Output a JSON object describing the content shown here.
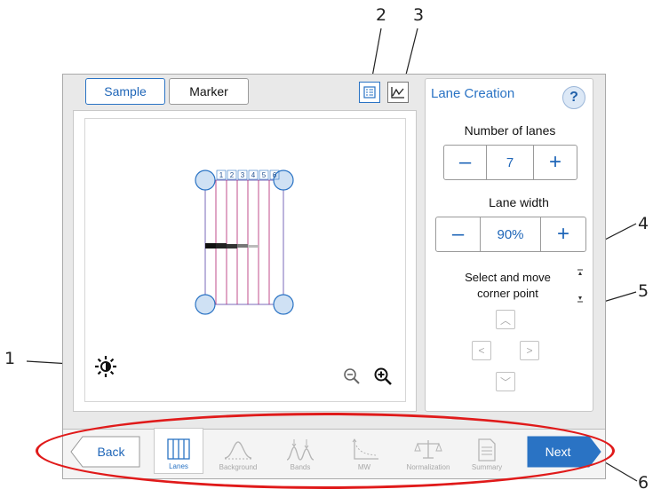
{
  "callouts": [
    "1",
    "2",
    "3",
    "4",
    "5",
    "6"
  ],
  "tabs": {
    "sample": "Sample",
    "marker": "Marker"
  },
  "view_buttons": {
    "list_icon": "list-view-icon",
    "chart_icon": "chart-view-icon"
  },
  "gel": {
    "lane_numbers": [
      "1",
      "2",
      "3",
      "4",
      "5",
      "6"
    ]
  },
  "image_tools": {
    "brightness_icon": "brightness-icon",
    "zoom_out_icon": "zoom-out-icon",
    "zoom_in_icon": "zoom-in-icon"
  },
  "lane_creation": {
    "title": "Lane Creation",
    "help": "?",
    "number_of_lanes_label": "Number of lanes",
    "number_of_lanes_value": "7",
    "lane_width_label": "Lane width",
    "lane_width_value": "90%",
    "minus": "–",
    "plus": "+",
    "corner_line1": "Select and move",
    "corner_line2": "corner point"
  },
  "workflow": {
    "back": "Back",
    "next": "Next",
    "steps": [
      "Lanes",
      "Background",
      "Bands",
      "MW",
      "Normalization",
      "Summary"
    ]
  },
  "colors": {
    "accent": "#2a73c4",
    "highlight": "#e01a1a",
    "lane_line": "#b0206e",
    "handle": "#cfe1f4"
  }
}
